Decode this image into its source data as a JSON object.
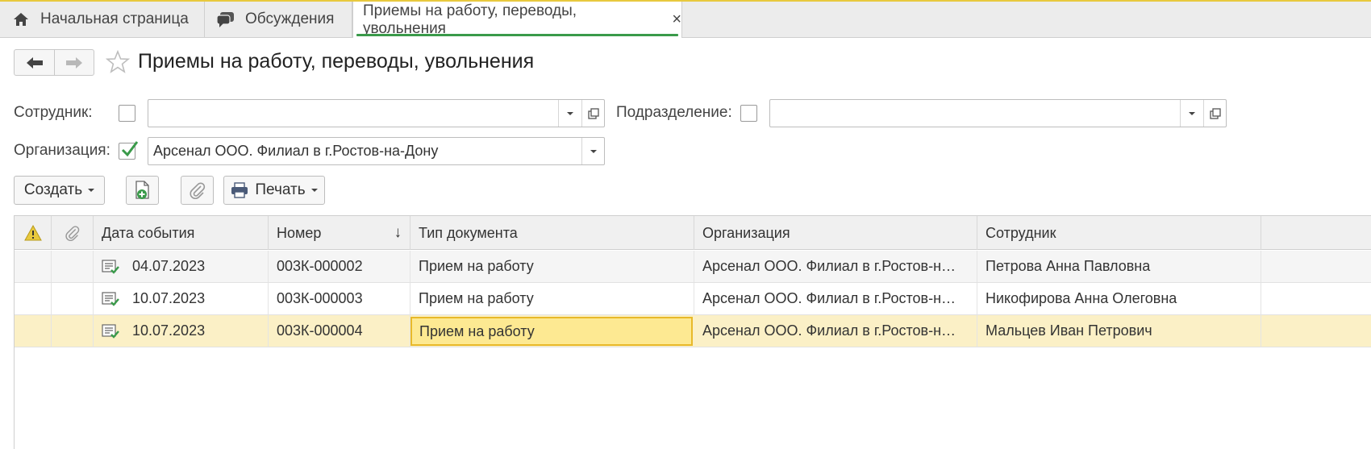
{
  "tabs": [
    {
      "label": "Начальная страница",
      "icon": "home-icon"
    },
    {
      "label": "Обсуждения",
      "icon": "chat-icon"
    },
    {
      "label": "Приемы на работу, переводы, увольнения",
      "close": "×",
      "active": true
    }
  ],
  "header": {
    "title": "Приемы на работу, переводы, увольнения"
  },
  "filters": {
    "employee": {
      "label": "Сотрудник:",
      "checked": false,
      "value": ""
    },
    "department": {
      "label": "Подразделение:",
      "checked": false,
      "value": ""
    },
    "organization": {
      "label": "Организация:",
      "checked": true,
      "value": "Арсенал ООО. Филиал в г.Ростов-на-Дону"
    }
  },
  "toolbar": {
    "create_label": "Создать",
    "print_label": "Печать"
  },
  "table": {
    "columns": [
      "Дата события",
      "Номер",
      "Тип документа",
      "Организация",
      "Сотрудник"
    ],
    "sort_indicator": "↓",
    "rows": [
      {
        "date": "04.07.2023",
        "number": "003К-000002",
        "doc_type": "Прием на работу",
        "organization": "Арсенал ООО. Филиал в г.Ростов-н…",
        "employee": "Петрова Анна Павловна"
      },
      {
        "date": "10.07.2023",
        "number": "003К-000003",
        "doc_type": "Прием на работу",
        "organization": "Арсенал ООО. Филиал в г.Ростов-н…",
        "employee": "Никофирова Анна Олеговна"
      },
      {
        "date": "10.07.2023",
        "number": "003К-000004",
        "doc_type": "Прием на работу",
        "organization": "Арсенал ООО. Филиал в г.Ростов-н…",
        "employee": "Мальцев Иван Петрович"
      }
    ]
  },
  "colors": {
    "accent_green": "#3a9a4a",
    "selection": "#fbf0c6",
    "focus_cell": "#fde992",
    "warning": "#e8c93e"
  }
}
